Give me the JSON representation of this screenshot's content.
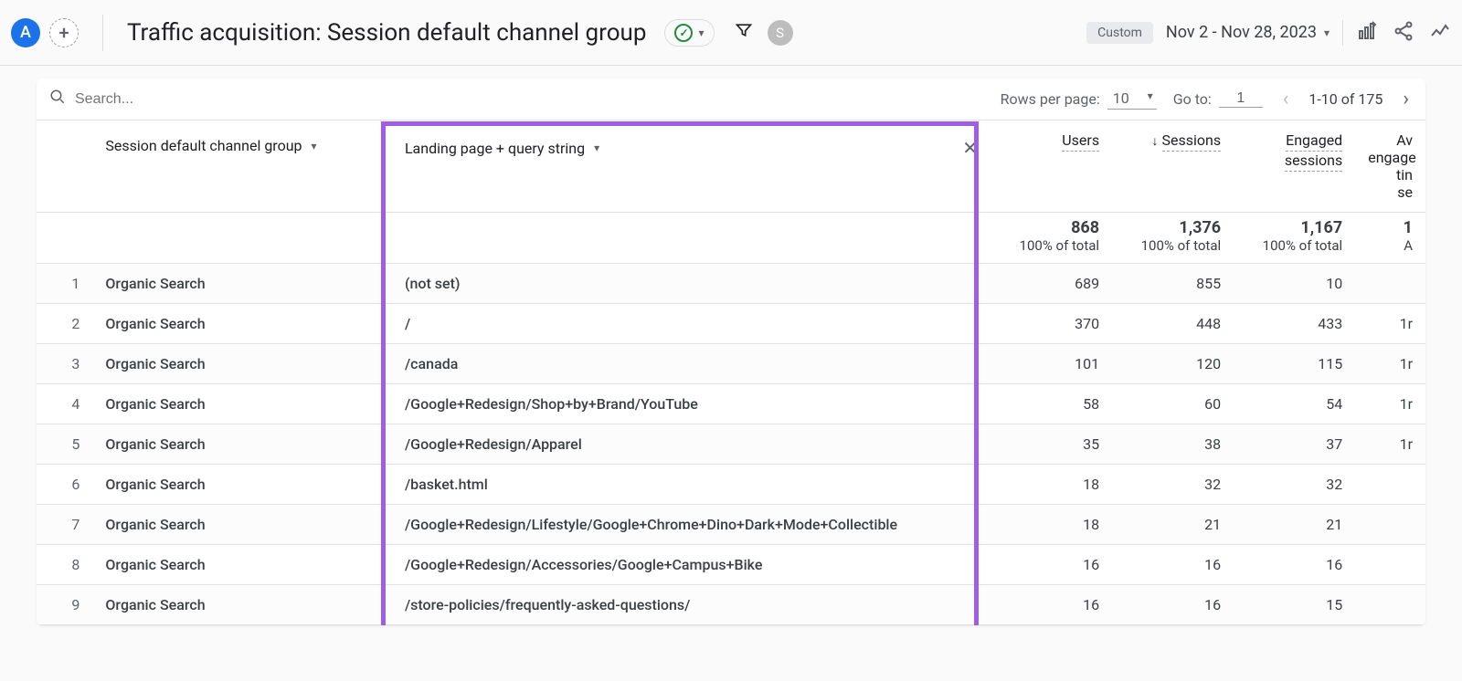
{
  "topbar": {
    "badge_a": "A",
    "title": "Traffic acquisition: Session default channel group",
    "s_badge": "S",
    "custom_label": "Custom",
    "date_range": "Nov 2 - Nov 28, 2023"
  },
  "search": {
    "placeholder": "Search..."
  },
  "pager": {
    "rows_per_page_label": "Rows per page:",
    "rows_per_page_value": "10",
    "goto_label": "Go to:",
    "goto_value": "1",
    "range_text": "1-10 of 175"
  },
  "columns": {
    "dim1": "Session default channel group",
    "dim2": "Landing page + query string",
    "users": "Users",
    "sessions": "Sessions",
    "engaged_line1": "Engaged",
    "engaged_line2": "sessions",
    "avg_line1": "Av",
    "avg_line2": "engage",
    "avg_line3": "tin",
    "avg_line4": "se"
  },
  "totals": {
    "users": "868",
    "sessions": "1,376",
    "engaged": "1,167",
    "avg": "1",
    "pct": "100% of total",
    "avg_sub": "A"
  },
  "rows": [
    {
      "n": "1",
      "group": "Organic Search",
      "lp": "(not set)",
      "users": "689",
      "sessions": "855",
      "engaged": "10",
      "avg": ""
    },
    {
      "n": "2",
      "group": "Organic Search",
      "lp": "/",
      "users": "370",
      "sessions": "448",
      "engaged": "433",
      "avg": "1r"
    },
    {
      "n": "3",
      "group": "Organic Search",
      "lp": "/canada",
      "users": "101",
      "sessions": "120",
      "engaged": "115",
      "avg": "1r"
    },
    {
      "n": "4",
      "group": "Organic Search",
      "lp": "/Google+Redesign/Shop+by+Brand/YouTube",
      "users": "58",
      "sessions": "60",
      "engaged": "54",
      "avg": "1r"
    },
    {
      "n": "5",
      "group": "Organic Search",
      "lp": "/Google+Redesign/Apparel",
      "users": "35",
      "sessions": "38",
      "engaged": "37",
      "avg": "1r"
    },
    {
      "n": "6",
      "group": "Organic Search",
      "lp": "/basket.html",
      "users": "18",
      "sessions": "32",
      "engaged": "32",
      "avg": ""
    },
    {
      "n": "7",
      "group": "Organic Search",
      "lp": "/Google+Redesign/Lifestyle/Google+Chrome+Dino+Dark+Mode+Collectible",
      "users": "18",
      "sessions": "21",
      "engaged": "21",
      "avg": ""
    },
    {
      "n": "8",
      "group": "Organic Search",
      "lp": "/Google+Redesign/Accessories/Google+Campus+Bike",
      "users": "16",
      "sessions": "16",
      "engaged": "16",
      "avg": ""
    },
    {
      "n": "9",
      "group": "Organic Search",
      "lp": "/store-policies/frequently-asked-questions/",
      "users": "16",
      "sessions": "16",
      "engaged": "15",
      "avg": ""
    }
  ]
}
